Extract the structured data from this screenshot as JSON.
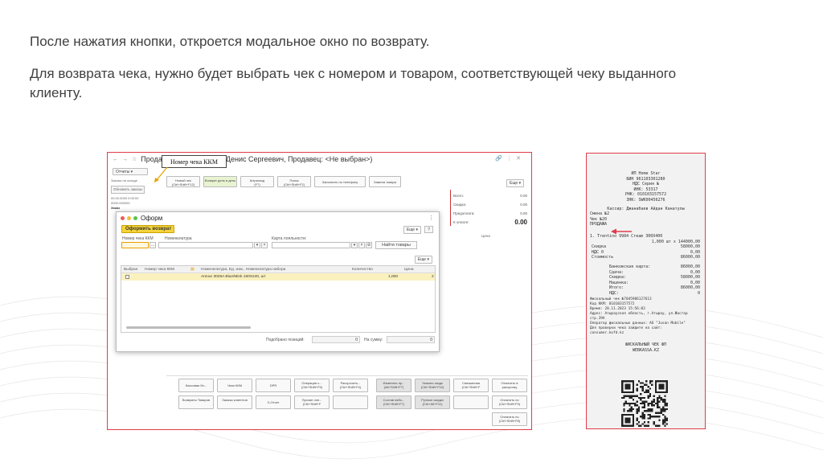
{
  "slide": {
    "line1": "После нажатия кнопки, откроется модальное окно по возврату.",
    "line2": "Для возврата чека, нужно будет выбрать чек с номером и товаром, соответствующей чеку выданного клиенту."
  },
  "window": {
    "title": "Продажа (Кассир: Белов Денис Сергеевич, Продавец: <Не выбран>)",
    "reports": "Отчеты",
    "side": {
      "orders_label": "Заказы на складе",
      "refresh": "Обновить заказы",
      "small1": "00.00.0000 0:00:00",
      "small2": "0000-000000",
      "orders_title": "Заказ"
    },
    "toolbar": [
      {
        "label": "Новый чек",
        "hotkey": "(Ctrl+Shift+F12)"
      },
      {
        "label": "Возврат день в день",
        "hotkey": ""
      },
      {
        "label": "Штрихкод",
        "hotkey": "(F7)"
      },
      {
        "label": "Поиск",
        "hotkey": "(Ctrl+Shift+F2)"
      },
      {
        "label": "Заполнить по телефону",
        "hotkey": ""
      },
      {
        "label": "Замена товара",
        "hotkey": ""
      }
    ],
    "more": "Еще",
    "totals": [
      {
        "label": "Всего:",
        "value": "0.00"
      },
      {
        "label": "Скидка:",
        "value": "0.00"
      },
      {
        "label": "Предоплата:",
        "value": "0.00"
      },
      {
        "label": "К оплате:",
        "value": "0.00"
      }
    ],
    "columns": {
      "c1": "Цена",
      "c2": "Цена"
    },
    "bottom_buttons": [
      {
        "label": "Кассовая бл...",
        "hotkey": ""
      },
      {
        "label": "Чеки ККМ",
        "hotkey": ""
      },
      {
        "label": "DPR",
        "hotkey": ""
      },
      {
        "label": "Операции с...",
        "hotkey": "(Ctrl+Shift+F5)"
      },
      {
        "label": "Рассрочить...",
        "hotkey": "(Ctrl+Shift+F4)"
      },
      {
        "label": "Изменить пр...",
        "hotkey": "(Alt+Shift+F7)"
      },
      {
        "label": "Указать скидк",
        "hotkey": "(Ctrl+Shift+F10)"
      },
      {
        "label": "Смешанная",
        "hotkey": "(Ctrl+Shift+F"
      },
      {
        "label": "Оплатить в",
        "hotkey": "рассрочку"
      },
      {
        "label": "Возвраты Товаров",
        "hotkey": ""
      },
      {
        "label": "Заказы клиентов",
        "hotkey": ""
      },
      {
        "label": "X-Отчет",
        "hotkey": ""
      },
      {
        "label": "Прочие опе...",
        "hotkey": "(Ctrl+Shift+F"
      },
      {
        "label": "",
        "hotkey": ""
      },
      {
        "label": "Состав набо...",
        "hotkey": "(Ctrl+Shift+F7)"
      },
      {
        "label": "Ручные скидки",
        "hotkey": "(Ctrl+Alt+F11)"
      },
      {
        "label": "",
        "hotkey": ""
      },
      {
        "label": "Оплатить по",
        "hotkey": "(Ctrl+Shift+F9)"
      },
      {
        "label": "Оплатить по",
        "hotkey": "(Ctrl+Shift+F8)"
      }
    ]
  },
  "modal": {
    "title": "Оформ",
    "submit": "Оформить возврат",
    "more": "Еще",
    "help": "?",
    "labels": {
      "receipt_no": "Номер чека ККМ",
      "nomenclature": "Номенклатура",
      "loyalty": "Карта лояльности:"
    },
    "find": "Найти товары",
    "grid_more": "Еще",
    "grid_headers": [
      "Выбран",
      "Номер чека ККМ",
      "Номенклатура, Ед. изм., Номенклатура набора",
      "Количество",
      "Цена"
    ],
    "grid_row": {
      "item": "Amour 3025A Blue/Mink 160X240, шт",
      "qty": "1,000",
      "price": "2"
    },
    "footer": {
      "positions_label": "Подобрано позиций:",
      "positions_value": "0",
      "sum_label": "На сумму:",
      "sum_value": "0"
    }
  },
  "tooltip": "Номер чека ККМ",
  "receipt": {
    "lines_center": [
      "ИП Home Star",
      "БИН 961103301280",
      "НДС Серия   №",
      "ИНК: 53317",
      "РНК: 010103157572",
      "ЗНК: SWK00456276"
    ],
    "cashier": "Кассир: Джанабаев Айдан Канатулы",
    "shift": "Смена №2",
    "check": "Чек №20",
    "sale": "ПРОДАЖА",
    "item": "1. Trentino 9984 Cream 300X400",
    "item_price": "1,000 шт x 144000,00",
    "rows1": [
      {
        "k": "Скидка",
        "v": "58000,00"
      },
      {
        "k": "НДС 0",
        "v": "0,00"
      },
      {
        "k": "Стоимость",
        "v": "86000,00"
      }
    ],
    "rows2": [
      {
        "k": "Банковская карта:",
        "v": "86000,00"
      },
      {
        "k": "Сдача:",
        "v": "0,00"
      },
      {
        "k": "Скидка:",
        "v": "58000,00"
      },
      {
        "k": "Наценка:",
        "v": "0,00"
      },
      {
        "k": "Итого:",
        "v": "86000,00"
      },
      {
        "k": "НДС:",
        "v": "0"
      }
    ],
    "footer_lines": [
      "Фискальный чек №7045986127613",
      "Код ККМ: 010103157572",
      "Время: 28.11.2023 15:56:03",
      "Адрес: Атырауская область, г.Атырау, ул.Жастар",
      "  стр.39А",
      "Оператор фискальных данных: АО \"Jusan Mobile\"",
      "Для проверки чека зайдите на сайт:",
      "consumer.kofd.kz"
    ],
    "fiscal": "ФИСКАЛЬНЫЙ ЧЕК ФП",
    "site": "WEBKASSA.KZ"
  },
  "colors": {
    "accent_red": "#e03c4a",
    "yellow_button": "#f5d33b",
    "selected_row": "#fbf1bf"
  }
}
